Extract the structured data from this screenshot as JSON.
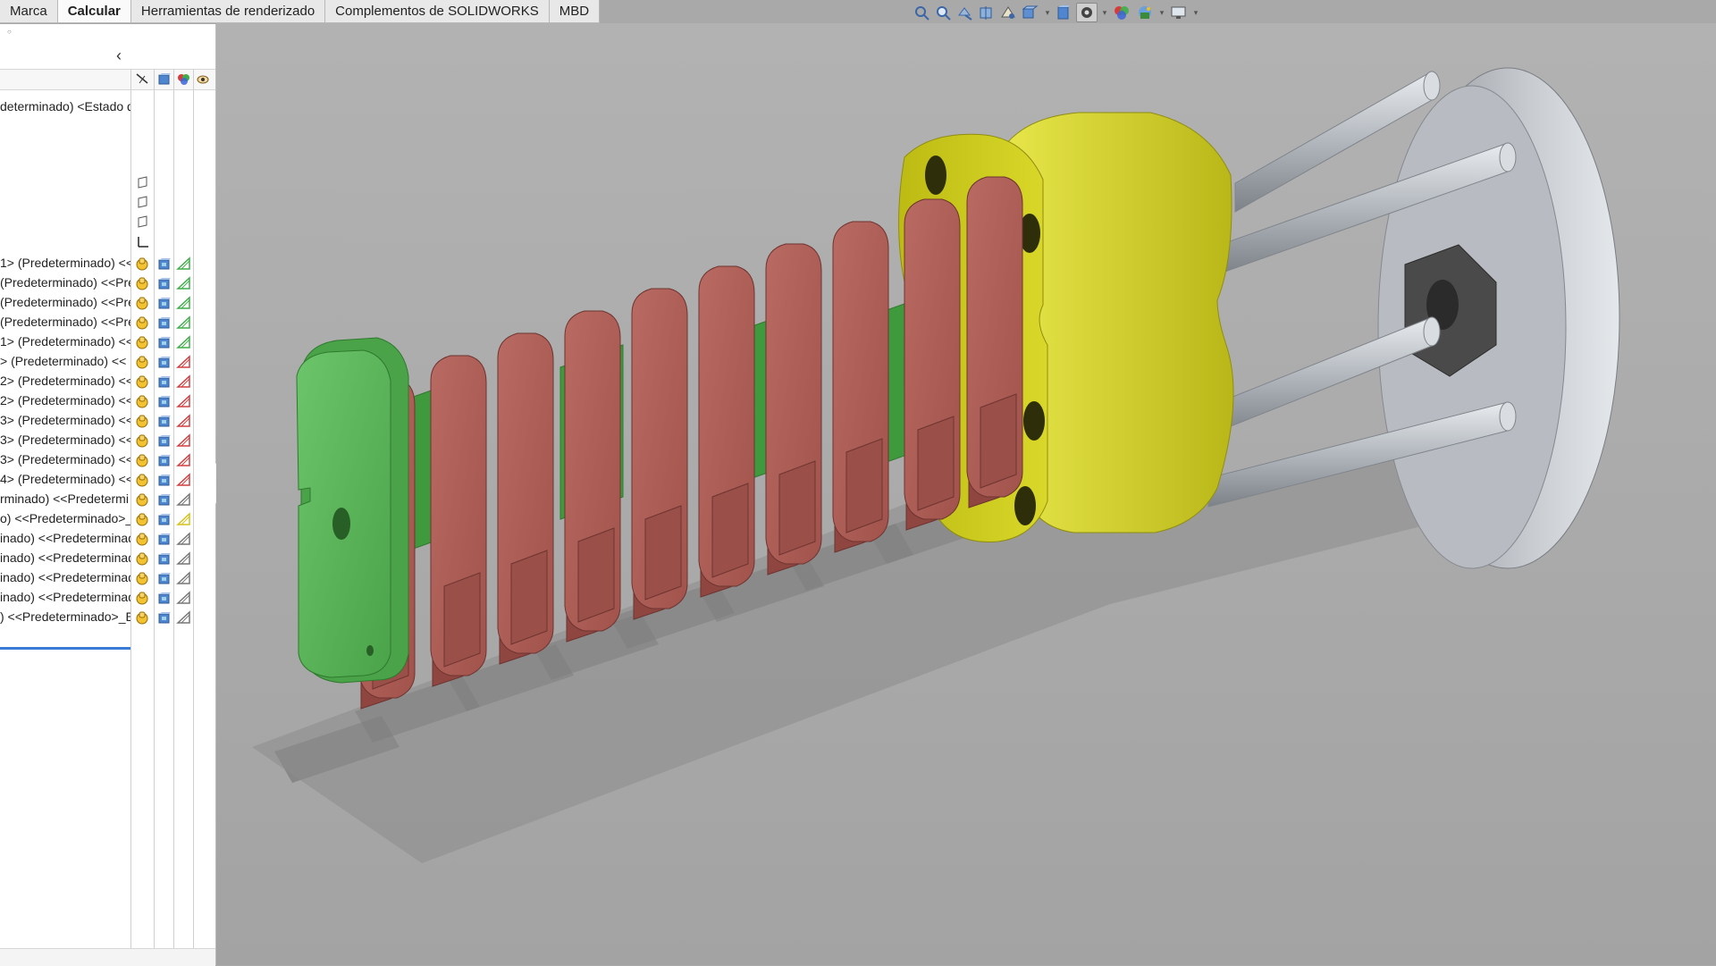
{
  "tabs": [
    "Marca",
    "Calcular",
    "Herramientas de renderizado",
    "Complementos de SOLIDWORKS",
    "MBD"
  ],
  "active_tab": "Calcular",
  "feature_tree": {
    "root_label": "determinado) <Estado de",
    "rows": [
      "1> (Predeterminado) <<",
      "(Predeterminado) <<Pre",
      "(Predeterminado) <<Pre",
      "(Predeterminado) <<Pre",
      "1> (Predeterminado) <<",
      "> (Predeterminado) <<",
      "2> (Predeterminado) <<",
      "2> (Predeterminado) <<",
      "3> (Predeterminado) <<",
      "3> (Predeterminado) <<",
      "3> (Predeterminado) <<",
      "4> (Predeterminado) <<",
      "rminado) <<Predetermi",
      "o) <<Predeterminado>_",
      "inado) <<Predeterminad",
      "inado) <<Predeterminad",
      "inado) <<Predeterminad",
      "inado) <<Predeterminad",
      ") <<Predeterminado>_E"
    ]
  },
  "colors": {
    "background": "#a9a9a9",
    "part_green": "#5bb65a",
    "part_red": "#b3635c",
    "part_yellow": "#d4d21a",
    "part_metal": "#b9bcc0",
    "selection": "#3a7bd5"
  },
  "icons": [
    "zoom-fit-icon",
    "zoom-area-icon",
    "previous-view-icon",
    "section-view-icon",
    "dynamic-annotation-icon",
    "view-orientation-icon",
    "display-style-icon",
    "hide-show-icon",
    "edit-appearance-icon",
    "apply-scene-icon",
    "view-settings-icon"
  ]
}
